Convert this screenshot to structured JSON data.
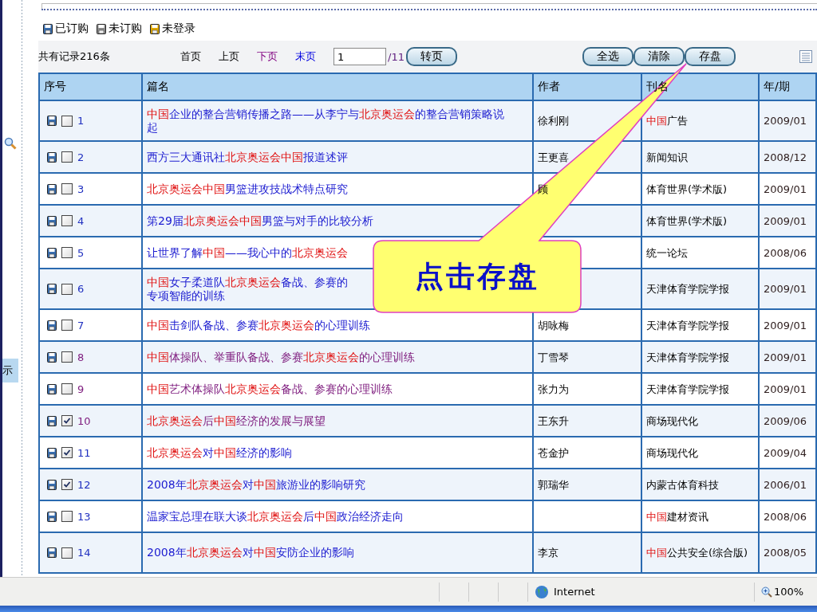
{
  "legend": [
    {
      "label": "已订购",
      "color": "#3a6fb0"
    },
    {
      "label": "未订购",
      "color": "#8a8a8a"
    },
    {
      "label": "未登录",
      "color": "#e0a800"
    }
  ],
  "side_tab": "示",
  "toolbar": {
    "record_count": "共有记录216条",
    "pager": [
      {
        "label": "首页",
        "visited": false,
        "kind": "plain"
      },
      {
        "label": "上页",
        "visited": false,
        "kind": "plain"
      },
      {
        "label": "下页",
        "visited": true,
        "kind": "link"
      },
      {
        "label": "末页",
        "visited": false,
        "kind": "link"
      }
    ],
    "page_value": "1",
    "page_total": "/11",
    "goto_button": "转页",
    "actions": [
      "全选",
      "清除",
      "存盘"
    ]
  },
  "table": {
    "columns": [
      "序号",
      "篇名",
      "作者",
      "刊名",
      "年/期"
    ],
    "rows": [
      {
        "number": "1",
        "checked": false,
        "visited": false,
        "title": [
          {
            "text": "中国",
            "highlight": true
          },
          {
            "text": "企业的整合营销传播之路——从李宁与",
            "highlight": false
          },
          {
            "text": "北京奥运会",
            "highlight": true
          },
          {
            "text": "的整合营销策略说起",
            "highlight": false
          }
        ],
        "author": "徐利刚",
        "journal": [
          {
            "text": "中国",
            "highlight": true
          },
          {
            "text": "广告",
            "highlight": false
          }
        ],
        "issue": "2009/01"
      },
      {
        "number": "2",
        "checked": false,
        "visited": false,
        "title": [
          {
            "text": "西方三大通讯社",
            "highlight": false
          },
          {
            "text": "北京奥运会",
            "highlight": true
          },
          {
            "text": "中国",
            "highlight": true
          },
          {
            "text": "报道述评",
            "highlight": false
          }
        ],
        "author": "王更喜",
        "journal": [
          {
            "text": "新闻知识",
            "highlight": false
          }
        ],
        "issue": "2008/12"
      },
      {
        "number": "3",
        "checked": false,
        "visited": false,
        "title": [
          {
            "text": "北京奥运会",
            "highlight": true
          },
          {
            "text": "中国",
            "highlight": true
          },
          {
            "text": "男篮进攻技战术特点研究",
            "highlight": false
          }
        ],
        "author": "顾",
        "journal": [
          {
            "text": "体育世界(学术版)",
            "highlight": false
          }
        ],
        "issue": "2009/01"
      },
      {
        "number": "4",
        "checked": false,
        "visited": false,
        "title": [
          {
            "text": "第29届",
            "highlight": false
          },
          {
            "text": "北京奥运会",
            "highlight": true
          },
          {
            "text": "中国",
            "highlight": true
          },
          {
            "text": "男篮与对手的比较分析",
            "highlight": false
          }
        ],
        "journal": [
          {
            "text": "体育世界(学术版)",
            "highlight": false
          }
        ],
        "issue": "2009/01"
      },
      {
        "number": "5",
        "checked": false,
        "visited": false,
        "title": [
          {
            "text": "让世界了解",
            "highlight": false
          },
          {
            "text": "中国",
            "highlight": true
          },
          {
            "text": "——我心中的",
            "highlight": false
          },
          {
            "text": "北京奥运会",
            "highlight": true
          }
        ],
        "journal": [
          {
            "text": "统一论坛",
            "highlight": false
          }
        ],
        "issue": "2008/06"
      },
      {
        "number": "6",
        "checked": false,
        "visited": false,
        "title": [
          {
            "text": "中国",
            "highlight": true
          },
          {
            "text": "女子柔道队",
            "highlight": false
          },
          {
            "text": "北京奥运会",
            "highlight": true
          },
          {
            "text": "备战、参赛的",
            "highlight": false
          },
          {
            "text": "专项智能的训练",
            "highlight": false,
            "newline": true
          }
        ],
        "journal": [
          {
            "text": "天津体育学院学报",
            "highlight": false
          }
        ],
        "issue": "2009/01"
      },
      {
        "number": "7",
        "checked": false,
        "visited": false,
        "title": [
          {
            "text": "中国",
            "highlight": true
          },
          {
            "text": "击剑队备战、参赛",
            "highlight": false
          },
          {
            "text": "北京奥运会",
            "highlight": true
          },
          {
            "text": "的心理训练",
            "highlight": false
          }
        ],
        "author": "胡咏梅",
        "journal": [
          {
            "text": "天津体育学院学报",
            "highlight": false
          }
        ],
        "issue": "2009/01"
      },
      {
        "number": "8",
        "checked": false,
        "visited": true,
        "title": [
          {
            "text": "中国",
            "highlight": true
          },
          {
            "text": "体操队、举重队备战、参赛",
            "highlight": false
          },
          {
            "text": "北京奥运会",
            "highlight": true
          },
          {
            "text": "的心理训练",
            "highlight": false
          }
        ],
        "author": "丁雪琴",
        "journal": [
          {
            "text": "天津体育学院学报",
            "highlight": false
          }
        ],
        "issue": "2009/01"
      },
      {
        "number": "9",
        "checked": false,
        "visited": true,
        "title": [
          {
            "text": "中国",
            "highlight": true
          },
          {
            "text": "艺术体操队",
            "highlight": false
          },
          {
            "text": "北京奥运会",
            "highlight": true
          },
          {
            "text": "备战、参赛的心理训练",
            "highlight": false
          }
        ],
        "author": "张力为",
        "journal": [
          {
            "text": "天津体育学院学报",
            "highlight": false
          }
        ],
        "issue": "2009/01"
      },
      {
        "number": "10",
        "checked": true,
        "visited": true,
        "title": [
          {
            "text": "北京奥运会",
            "highlight": true
          },
          {
            "text": "后",
            "highlight": false
          },
          {
            "text": "中国",
            "highlight": true
          },
          {
            "text": "经济的发展与展望",
            "highlight": false
          }
        ],
        "author": "王东升",
        "journal": [
          {
            "text": "商场现代化",
            "highlight": false
          }
        ],
        "issue": "2009/06"
      },
      {
        "number": "11",
        "checked": true,
        "visited": false,
        "title": [
          {
            "text": "北京奥运会",
            "highlight": true
          },
          {
            "text": "对",
            "highlight": false
          },
          {
            "text": "中国",
            "highlight": true
          },
          {
            "text": "经济的影响",
            "highlight": false
          }
        ],
        "author": "苍金护",
        "journal": [
          {
            "text": "商场现代化",
            "highlight": false
          }
        ],
        "issue": "2009/04"
      },
      {
        "number": "12",
        "checked": true,
        "visited": false,
        "title": [
          {
            "text": "2008年",
            "highlight": false
          },
          {
            "text": "北京奥运会",
            "highlight": true
          },
          {
            "text": "对",
            "highlight": false
          },
          {
            "text": "中国",
            "highlight": true
          },
          {
            "text": "旅游业的影响研究",
            "highlight": false
          }
        ],
        "author": "郭瑞华",
        "journal": [
          {
            "text": "内蒙古体育科技",
            "highlight": false
          }
        ],
        "issue": "2006/01"
      },
      {
        "number": "13",
        "checked": false,
        "visited": false,
        "title": [
          {
            "text": "温家宝总理在联大谈",
            "highlight": false
          },
          {
            "text": "北京奥运会",
            "highlight": true
          },
          {
            "text": "后",
            "highlight": false
          },
          {
            "text": "中国",
            "highlight": true
          },
          {
            "text": "政治经济走向",
            "highlight": false
          }
        ],
        "journal": [
          {
            "text": "中国",
            "highlight": true
          },
          {
            "text": "建材资讯",
            "highlight": false
          }
        ],
        "issue": "2008/06"
      },
      {
        "number": "14",
        "checked": false,
        "visited": false,
        "title": [
          {
            "text": "2008年",
            "highlight": false
          },
          {
            "text": "北京奥运会",
            "highlight": true
          },
          {
            "text": "对",
            "highlight": false
          },
          {
            "text": "中国",
            "highlight": true
          },
          {
            "text": "安防企业的影响",
            "highlight": false
          }
        ],
        "author": "李京",
        "journal": [
          {
            "text": "中国",
            "highlight": true
          },
          {
            "text": "公共安全(综合版)",
            "highlight": false
          }
        ],
        "issue": "2008/05"
      }
    ]
  },
  "callout": {
    "text": "点击存盘"
  },
  "status_bar": {
    "zone": "Internet",
    "zoom": "100%"
  }
}
